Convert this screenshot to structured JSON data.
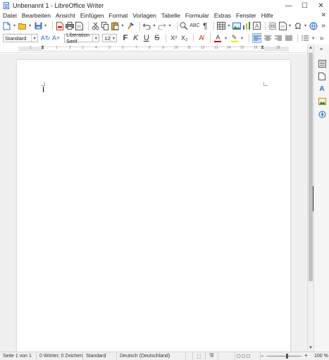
{
  "window": {
    "title": "Unbenannt 1 - LibreOffice Writer",
    "controls": {
      "minimize": "—",
      "maximize": "☐",
      "close": "✕"
    }
  },
  "menubar": {
    "items": [
      "Datei",
      "Bearbeiten",
      "Ansicht",
      "Einfügen",
      "Format",
      "Vorlagen",
      "Tabelle",
      "Formular",
      "Extras",
      "Fenster",
      "Hilfe"
    ],
    "close_doc": "✕"
  },
  "toolbar_standard": {
    "icons": [
      "new-document-icon",
      "open-folder-icon",
      "save-icon",
      "export-pdf-icon",
      "print-icon",
      "print-preview-icon",
      "cut-icon",
      "copy-icon",
      "paste-icon",
      "clone-formatting-icon",
      "undo-icon",
      "redo-icon",
      "find-replace-icon",
      "spelling-icon",
      "formatting-marks-icon",
      "insert-table-icon",
      "insert-image-icon",
      "insert-chart-icon",
      "insert-textbox-icon",
      "page-break-icon",
      "insert-field-icon",
      "special-character-icon",
      "hyperlink-icon"
    ],
    "overflow": "»"
  },
  "toolbar_formatting": {
    "paragraph_style": "Standard",
    "font_name": "Liberation Serif",
    "font_size": "12",
    "bold": "F",
    "italic": "K",
    "underline": "U",
    "strikethrough": "S",
    "superscript": "X²",
    "subscript": "X₂",
    "overflow": "»",
    "accent_color": "#cfe0f5",
    "font_color": "#c00000",
    "highlight_color": "#ffe600"
  },
  "ruler": {
    "numbers": [
      "1",
      "1",
      "2",
      "3",
      "4",
      "5",
      "6",
      "7",
      "8",
      "9",
      "10",
      "11",
      "12",
      "13",
      "14",
      "15",
      "16",
      "18"
    ]
  },
  "statusbar": {
    "page": "Seite 1 von 1",
    "words": "0 Wörter, 0 Zeichen",
    "page_style": "Standard",
    "language": "Deutsch (Deutschland)",
    "zoom_minus": "−",
    "zoom_plus": "+",
    "zoom": "100 %"
  },
  "scrollbar": {
    "up": "▲",
    "down": "▼"
  }
}
